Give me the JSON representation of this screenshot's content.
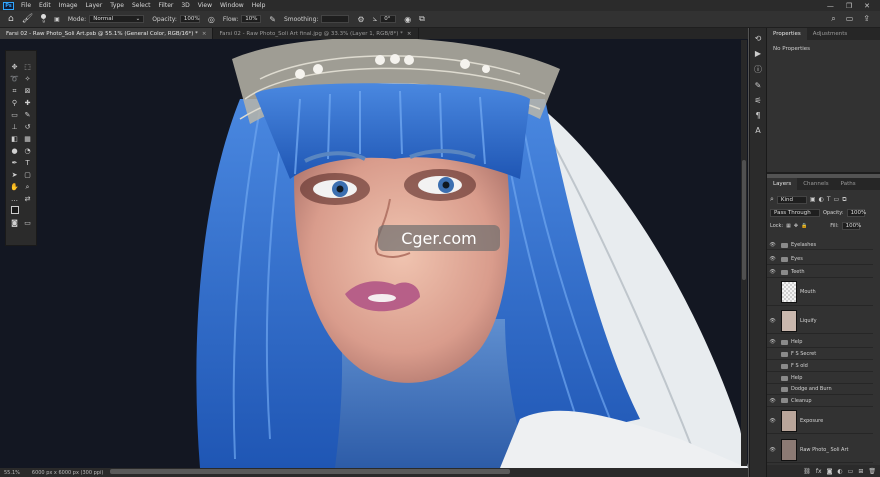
{
  "menubar": {
    "logo": "Ps",
    "items": [
      "File",
      "Edit",
      "Image",
      "Layer",
      "Type",
      "Select",
      "Filter",
      "3D",
      "View",
      "Window",
      "Help"
    ],
    "controls": [
      "—",
      "❐",
      "✕"
    ]
  },
  "options": {
    "size": "9",
    "mode_label": "Mode:",
    "mode_value": "Normal",
    "opacity_label": "Opacity:",
    "opacity_value": "100%",
    "flow_label": "Flow:",
    "flow_value": "10%",
    "smoothing_label": "Smoothing:",
    "angle_value": "0°"
  },
  "tabs": [
    {
      "label": "Farsi 02 - Raw Photo_Soli Art.psb @ 55.1% (General Color, RGB/16*) *",
      "active": true
    },
    {
      "label": "Farsi 02 - Raw Photo_Soli Art final.jpg @ 33.3% (Layer 1, RGB/8*) *",
      "active": false
    }
  ],
  "status": {
    "zoom": "55.1%",
    "size": "6000 px x 6000 px (300 ppi)"
  },
  "properties": {
    "tabs": [
      "Properties",
      "Adjustments"
    ],
    "empty": "No Properties"
  },
  "layers": {
    "tabs": [
      "Layers",
      "Channels",
      "Paths"
    ],
    "filter": "Kind",
    "blend": "Pass Through",
    "opacity_label": "Opacity:",
    "opacity": "100%",
    "lock_label": "Lock:",
    "fill_label": "Fill:",
    "fill": "100%",
    "items": [
      {
        "name": "Eyelashes",
        "type": "folder",
        "visible": true
      },
      {
        "name": "Eyes",
        "type": "folder",
        "visible": true
      },
      {
        "name": "Teeth",
        "type": "folder",
        "visible": true
      },
      {
        "name": "Mouth",
        "type": "layer",
        "visible": false
      },
      {
        "name": "Liquify",
        "type": "layer",
        "visible": true
      },
      {
        "name": "Help",
        "type": "folder",
        "visible": true
      },
      {
        "name": "F S Secret",
        "type": "folder",
        "visible": false
      },
      {
        "name": "F S old",
        "type": "folder",
        "visible": false
      },
      {
        "name": "Help",
        "type": "folder",
        "visible": false
      },
      {
        "name": "Dodge and Burn",
        "type": "folder",
        "visible": false
      },
      {
        "name": "Cleanup",
        "type": "folder",
        "visible": true
      },
      {
        "name": "Exposure",
        "type": "layer",
        "visible": true
      },
      {
        "name": "Raw Photo_ Soli Art",
        "type": "layer",
        "visible": true
      }
    ]
  },
  "watermark": "Cger.com",
  "colors": {
    "hair": "#2f6fd0",
    "bg": "#131722",
    "panel": "#323232"
  }
}
